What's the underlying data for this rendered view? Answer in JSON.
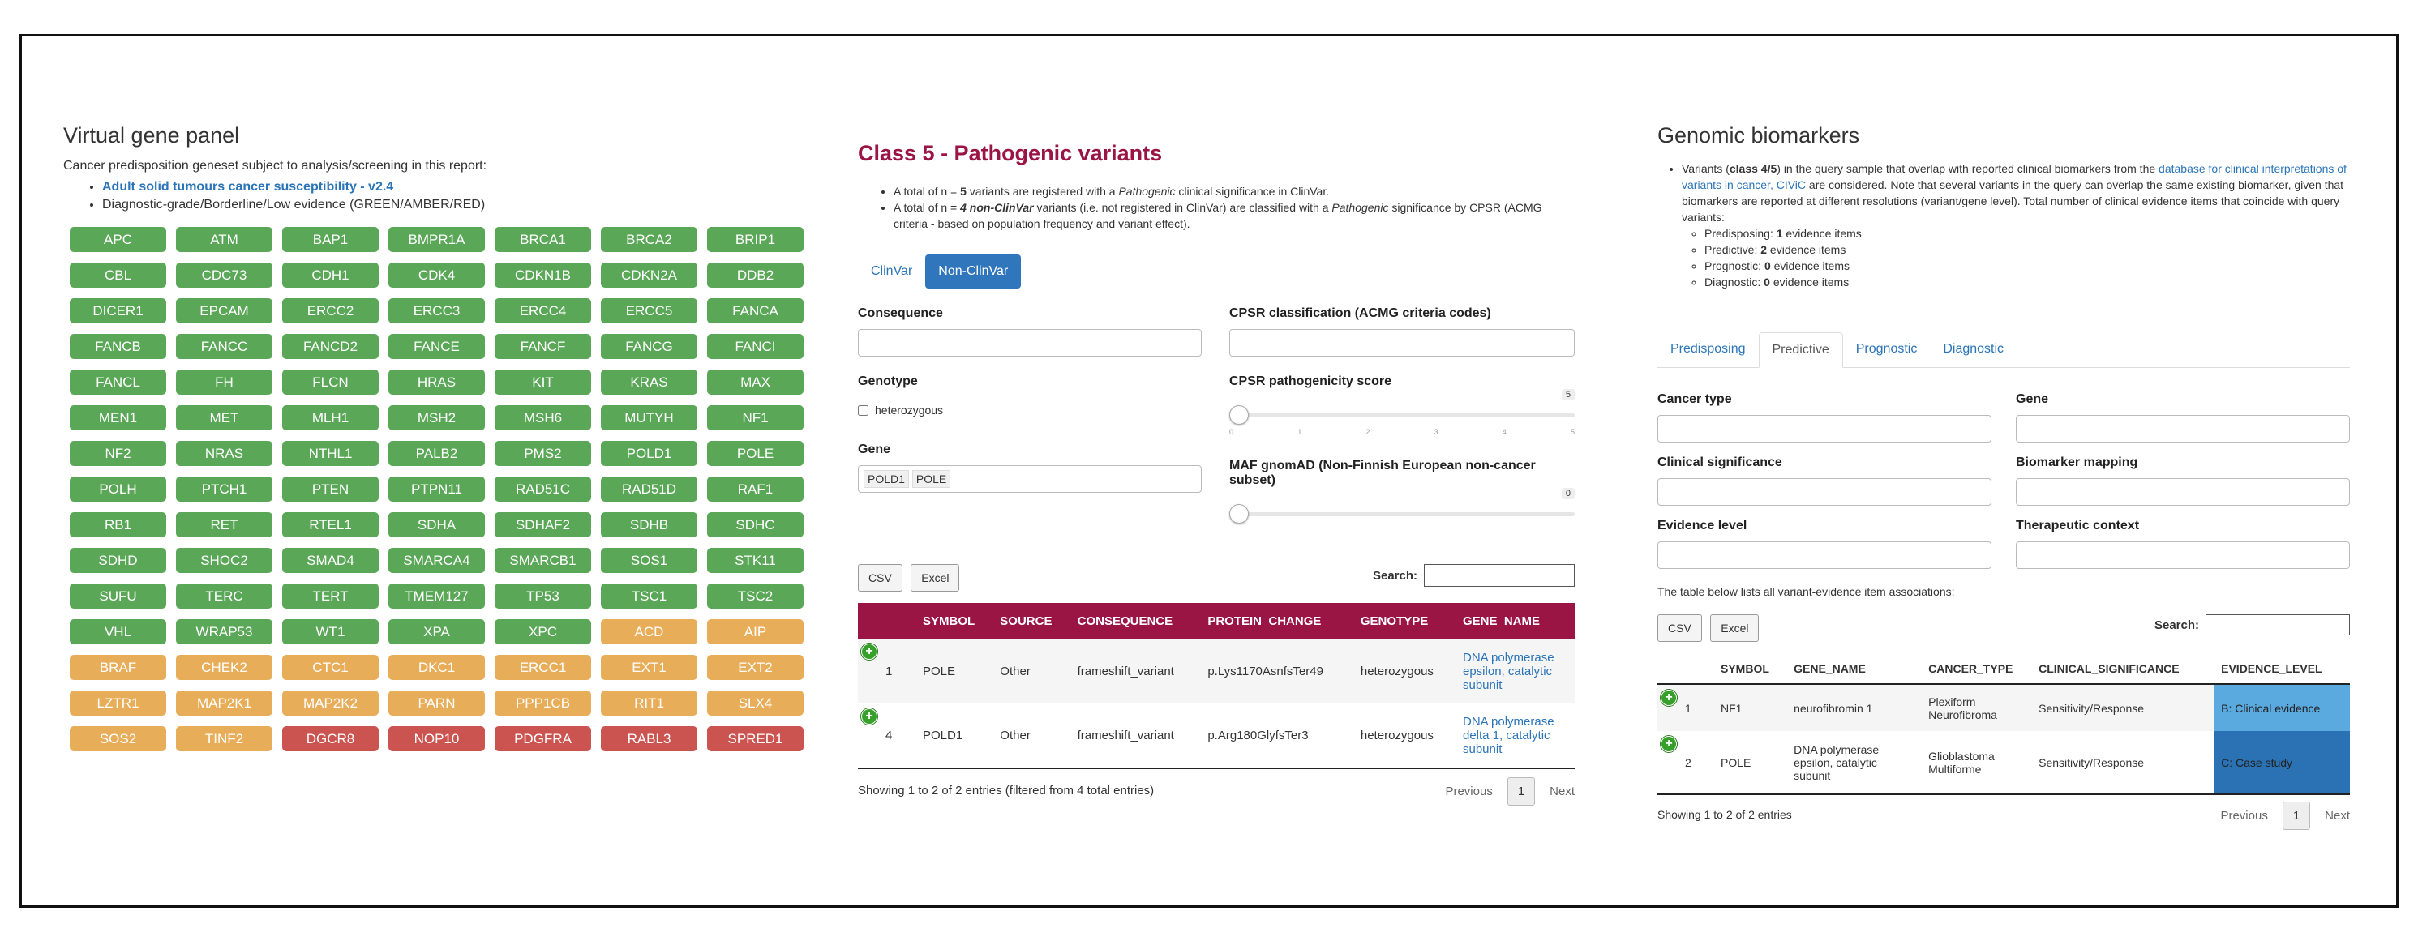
{
  "panel": {
    "title": "Virtual gene panel",
    "intro": "Cancer predisposition geneset subject to analysis/screening in this report:",
    "bullet_link": "Adult solid tumours cancer susceptibility - v2.4",
    "bullet_text": "Diagnostic-grade/Borderline/Low evidence (GREEN/AMBER/RED)",
    "genes": [
      [
        "APC",
        "g"
      ],
      [
        "ATM",
        "g"
      ],
      [
        "BAP1",
        "g"
      ],
      [
        "BMPR1A",
        "g"
      ],
      [
        "BRCA1",
        "g"
      ],
      [
        "BRCA2",
        "g"
      ],
      [
        "BRIP1",
        "g"
      ],
      [
        "CBL",
        "g"
      ],
      [
        "CDC73",
        "g"
      ],
      [
        "CDH1",
        "g"
      ],
      [
        "CDK4",
        "g"
      ],
      [
        "CDKN1B",
        "g"
      ],
      [
        "CDKN2A",
        "g"
      ],
      [
        "DDB2",
        "g"
      ],
      [
        "DICER1",
        "g"
      ],
      [
        "EPCAM",
        "g"
      ],
      [
        "ERCC2",
        "g"
      ],
      [
        "ERCC3",
        "g"
      ],
      [
        "ERCC4",
        "g"
      ],
      [
        "ERCC5",
        "g"
      ],
      [
        "FANCA",
        "g"
      ],
      [
        "FANCB",
        "g"
      ],
      [
        "FANCC",
        "g"
      ],
      [
        "FANCD2",
        "g"
      ],
      [
        "FANCE",
        "g"
      ],
      [
        "FANCF",
        "g"
      ],
      [
        "FANCG",
        "g"
      ],
      [
        "FANCI",
        "g"
      ],
      [
        "FANCL",
        "g"
      ],
      [
        "FH",
        "g"
      ],
      [
        "FLCN",
        "g"
      ],
      [
        "HRAS",
        "g"
      ],
      [
        "KIT",
        "g"
      ],
      [
        "KRAS",
        "g"
      ],
      [
        "MAX",
        "g"
      ],
      [
        "MEN1",
        "g"
      ],
      [
        "MET",
        "g"
      ],
      [
        "MLH1",
        "g"
      ],
      [
        "MSH2",
        "g"
      ],
      [
        "MSH6",
        "g"
      ],
      [
        "MUTYH",
        "g"
      ],
      [
        "NF1",
        "g"
      ],
      [
        "NF2",
        "g"
      ],
      [
        "NRAS",
        "g"
      ],
      [
        "NTHL1",
        "g"
      ],
      [
        "PALB2",
        "g"
      ],
      [
        "PMS2",
        "g"
      ],
      [
        "POLD1",
        "g"
      ],
      [
        "POLE",
        "g"
      ],
      [
        "POLH",
        "g"
      ],
      [
        "PTCH1",
        "g"
      ],
      [
        "PTEN",
        "g"
      ],
      [
        "PTPN11",
        "g"
      ],
      [
        "RAD51C",
        "g"
      ],
      [
        "RAD51D",
        "g"
      ],
      [
        "RAF1",
        "g"
      ],
      [
        "RB1",
        "g"
      ],
      [
        "RET",
        "g"
      ],
      [
        "RTEL1",
        "g"
      ],
      [
        "SDHA",
        "g"
      ],
      [
        "SDHAF2",
        "g"
      ],
      [
        "SDHB",
        "g"
      ],
      [
        "SDHC",
        "g"
      ],
      [
        "SDHD",
        "g"
      ],
      [
        "SHOC2",
        "g"
      ],
      [
        "SMAD4",
        "g"
      ],
      [
        "SMARCA4",
        "g"
      ],
      [
        "SMARCB1",
        "g"
      ],
      [
        "SOS1",
        "g"
      ],
      [
        "STK11",
        "g"
      ],
      [
        "SUFU",
        "g"
      ],
      [
        "TERC",
        "g"
      ],
      [
        "TERT",
        "g"
      ],
      [
        "TMEM127",
        "g"
      ],
      [
        "TP53",
        "g"
      ],
      [
        "TSC1",
        "g"
      ],
      [
        "TSC2",
        "g"
      ],
      [
        "VHL",
        "g"
      ],
      [
        "WRAP53",
        "g"
      ],
      [
        "WT1",
        "g"
      ],
      [
        "XPA",
        "g"
      ],
      [
        "XPC",
        "g"
      ],
      [
        "ACD",
        "a"
      ],
      [
        "AIP",
        "a"
      ],
      [
        "BRAF",
        "a"
      ],
      [
        "CHEK2",
        "a"
      ],
      [
        "CTC1",
        "a"
      ],
      [
        "DKC1",
        "a"
      ],
      [
        "ERCC1",
        "a"
      ],
      [
        "EXT1",
        "a"
      ],
      [
        "EXT2",
        "a"
      ],
      [
        "LZTR1",
        "a"
      ],
      [
        "MAP2K1",
        "a"
      ],
      [
        "MAP2K2",
        "a"
      ],
      [
        "PARN",
        "a"
      ],
      [
        "PPP1CB",
        "a"
      ],
      [
        "RIT1",
        "a"
      ],
      [
        "SLX4",
        "a"
      ],
      [
        "SOS2",
        "a"
      ],
      [
        "TINF2",
        "a"
      ],
      [
        "DGCR8",
        "r"
      ],
      [
        "NOP10",
        "r"
      ],
      [
        "PDGFRA",
        "r"
      ],
      [
        "RABL3",
        "r"
      ],
      [
        "SPRED1",
        "r"
      ]
    ],
    "colors": {
      "green": "#5aa857",
      "amber": "#e8ad59",
      "red": "#cc5450"
    }
  },
  "class5": {
    "title": "Class 5 - Pathogenic variants",
    "b1_pre": "A total of n = ",
    "b1_n": "5",
    "b1_mid": " variants are registered with a ",
    "b1_em": "Pathogenic",
    "b1_post": " clinical significance in ClinVar.",
    "b2_pre": "A total of n = ",
    "b2_n": "4 non-ClinVar",
    "b2_mid": " variants (i.e. not registered in ClinVar) are classified with a ",
    "b2_em": "Pathogenic",
    "b2_post": " significance by CPSR (ACMG criteria - based on population frequency and variant effect).",
    "tabs": [
      "ClinVar",
      "Non-ClinVar"
    ],
    "filters": {
      "consequence": "Consequence",
      "cpsr_class": "CPSR classification (ACMG criteria codes)",
      "genotype": "Genotype",
      "genotype_opt": "heterozygous",
      "score": "CPSR pathogenicity score",
      "score_val": "5",
      "gene": "Gene",
      "gene_tags": [
        "POLD1",
        "POLE"
      ],
      "maf": "MAF gnomAD (Non-Finnish European non-cancer subset)",
      "maf_val": "0"
    },
    "csv": "CSV",
    "excel": "Excel",
    "search": "Search:",
    "columns": [
      "SYMBOL",
      "SOURCE",
      "CONSEQUENCE",
      "PROTEIN_CHANGE",
      "GENOTYPE",
      "GENE_NAME"
    ],
    "rows": [
      {
        "idx": "1",
        "symbol": "POLE",
        "source": "Other",
        "consequence": "frameshift_variant",
        "protein": "p.Lys1170AsnfsTer49",
        "genotype": "heterozygous",
        "gene_name": "DNA polymerase epsilon, catalytic subunit"
      },
      {
        "idx": "4",
        "symbol": "POLD1",
        "source": "Other",
        "consequence": "frameshift_variant",
        "protein": "p.Arg180GlyfsTer3",
        "genotype": "heterozygous",
        "gene_name": "DNA polymerase delta 1, catalytic subunit"
      }
    ],
    "footer": "Showing 1 to 2 of 2 entries (filtered from 4 total entries)",
    "prev": "Previous",
    "page": "1",
    "next": "Next",
    "header_color": "#9a1444"
  },
  "biomarkers": {
    "title": "Genomic biomarkers",
    "p_pre": "Variants (",
    "p_bold": "class 4/5",
    "p_mid": ") in the query sample that overlap with reported clinical biomarkers from the ",
    "p_link": "database for clinical interpretations of variants in cancer, CIViC",
    "p_post": " are considered. Note that several variants in the query can overlap the same existing biomarker, given that biomarkers are reported at different resolutions (variant/gene level). Total number of clinical evidence items that coincide with query variants:",
    "counts": [
      {
        "label": "Predisposing: ",
        "n": "1",
        "suffix": " evidence items"
      },
      {
        "label": "Predictive: ",
        "n": "2",
        "suffix": " evidence items"
      },
      {
        "label": "Prognostic: ",
        "n": "0",
        "suffix": " evidence items"
      },
      {
        "label": "Diagnostic: ",
        "n": "0",
        "suffix": " evidence items"
      }
    ],
    "tabs": [
      "Predisposing",
      "Predictive",
      "Prognostic",
      "Diagnostic"
    ],
    "filters": [
      "Cancer type",
      "Gene",
      "Clinical significance",
      "Biomarker mapping",
      "Evidence level",
      "Therapeutic context"
    ],
    "table_note": "The table below lists all variant-evidence item associations:",
    "csv": "CSV",
    "excel": "Excel",
    "search": "Search:",
    "columns": [
      "SYMBOL",
      "GENE_NAME",
      "CANCER_TYPE",
      "CLINICAL_SIGNIFICANCE",
      "EVIDENCE_LEVEL"
    ],
    "rows": [
      {
        "idx": "1",
        "symbol": "NF1",
        "gene_name": "neurofibromin 1",
        "cancer_type": "Plexiform Neurofibroma",
        "significance": "Sensitivity/Response",
        "level": "B: Clinical evidence",
        "level_color": "#5aaae0"
      },
      {
        "idx": "2",
        "symbol": "POLE",
        "gene_name": "DNA polymerase epsilon, catalytic subunit",
        "cancer_type": "Glioblastoma Multiforme",
        "significance": "Sensitivity/Response",
        "level": "C: Case study",
        "level_color": "#2b72b5"
      }
    ],
    "footer": "Showing 1 to 2 of 2 entries",
    "prev": "Previous",
    "page": "1",
    "next": "Next"
  }
}
